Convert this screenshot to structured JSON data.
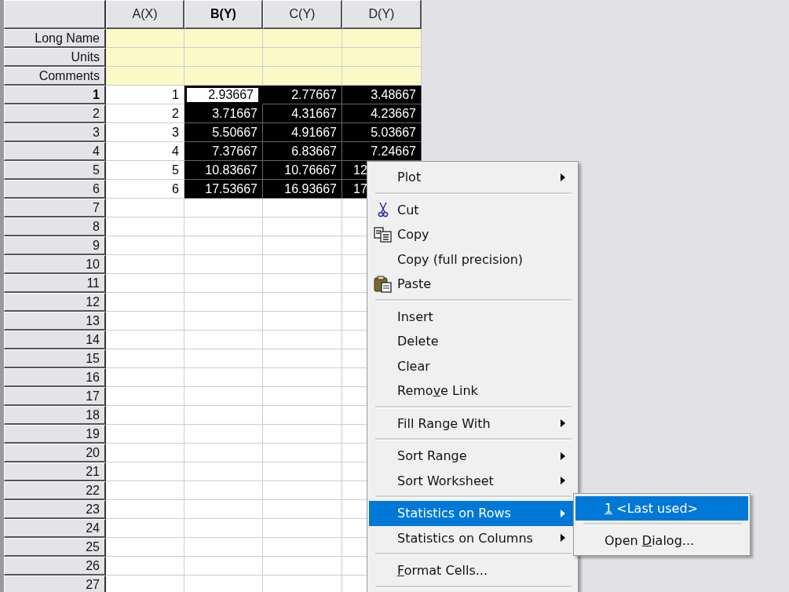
{
  "columns": [
    {
      "label": "A(X)",
      "active": false
    },
    {
      "label": "B(Y)",
      "active": true
    },
    {
      "label": "C(Y)",
      "active": false
    },
    {
      "label": "D(Y)",
      "active": false
    }
  ],
  "label_rows": [
    {
      "label": "Long Name"
    },
    {
      "label": "Units"
    },
    {
      "label": "Comments"
    }
  ],
  "rows": [
    {
      "label": "1",
      "active": true,
      "cells": [
        {
          "value": "1",
          "selected": false,
          "active": false
        },
        {
          "value": "2.93667",
          "selected": true,
          "active": true
        },
        {
          "value": "2.77667",
          "selected": true,
          "active": false
        },
        {
          "value": "3.48667",
          "selected": true,
          "active": false
        }
      ]
    },
    {
      "label": "2",
      "active": false,
      "cells": [
        {
          "value": "2",
          "selected": false,
          "active": false
        },
        {
          "value": "3.71667",
          "selected": true,
          "active": false
        },
        {
          "value": "4.31667",
          "selected": true,
          "active": false
        },
        {
          "value": "4.23667",
          "selected": true,
          "active": false
        }
      ]
    },
    {
      "label": "3",
      "active": false,
      "cells": [
        {
          "value": "3",
          "selected": false,
          "active": false
        },
        {
          "value": "5.50667",
          "selected": true,
          "active": false
        },
        {
          "value": "4.91667",
          "selected": true,
          "active": false
        },
        {
          "value": "5.03667",
          "selected": true,
          "active": false
        }
      ]
    },
    {
      "label": "4",
      "active": false,
      "cells": [
        {
          "value": "4",
          "selected": false,
          "active": false
        },
        {
          "value": "7.37667",
          "selected": true,
          "active": false
        },
        {
          "value": "6.83667",
          "selected": true,
          "active": false
        },
        {
          "value": "7.24667",
          "selected": true,
          "active": false
        }
      ]
    },
    {
      "label": "5",
      "active": false,
      "cells": [
        {
          "value": "5",
          "selected": false,
          "active": false
        },
        {
          "value": "10.83667",
          "selected": true,
          "active": false
        },
        {
          "value": "10.76667",
          "selected": true,
          "active": false
        },
        {
          "value": "12",
          "selected": true,
          "active": false,
          "cut": true
        }
      ]
    },
    {
      "label": "6",
      "active": false,
      "cells": [
        {
          "value": "6",
          "selected": false,
          "active": false
        },
        {
          "value": "17.53667",
          "selected": true,
          "active": false
        },
        {
          "value": "16.93667",
          "selected": true,
          "active": false
        },
        {
          "value": "17",
          "selected": true,
          "active": false,
          "cut": true
        }
      ]
    },
    {
      "label": "7",
      "active": false
    },
    {
      "label": "8",
      "active": false
    },
    {
      "label": "9",
      "active": false
    },
    {
      "label": "10",
      "active": false
    },
    {
      "label": "11",
      "active": false
    },
    {
      "label": "12",
      "active": false
    },
    {
      "label": "13",
      "active": false
    },
    {
      "label": "14",
      "active": false
    },
    {
      "label": "15",
      "active": false
    },
    {
      "label": "16",
      "active": false
    },
    {
      "label": "17",
      "active": false
    },
    {
      "label": "18",
      "active": false
    },
    {
      "label": "19",
      "active": false
    },
    {
      "label": "20",
      "active": false
    },
    {
      "label": "21",
      "active": false
    },
    {
      "label": "22",
      "active": false
    },
    {
      "label": "23",
      "active": false
    },
    {
      "label": "24",
      "active": false
    },
    {
      "label": "25",
      "active": false
    },
    {
      "label": "26",
      "active": false
    },
    {
      "label": "27",
      "active": false
    }
  ],
  "context_menu": {
    "items": [
      {
        "kind": "item",
        "label": [
          {
            "text": "Plot"
          }
        ],
        "submenu": true,
        "highlighted": false
      },
      {
        "kind": "separator"
      },
      {
        "kind": "cut",
        "label": [
          {
            "text": "Cut"
          }
        ],
        "submenu": false,
        "highlighted": false
      },
      {
        "kind": "copy",
        "label": [
          {
            "text": "Copy"
          }
        ],
        "submenu": false,
        "highlighted": false
      },
      {
        "kind": "item",
        "label": [
          {
            "text": "Copy (full precision)"
          }
        ],
        "submenu": false,
        "highlighted": false
      },
      {
        "kind": "paste",
        "label": [
          {
            "text": "Paste"
          }
        ],
        "submenu": false,
        "highlighted": false
      },
      {
        "kind": "separator"
      },
      {
        "kind": "item",
        "label": [
          {
            "text": "Insert"
          }
        ],
        "submenu": false,
        "highlighted": false
      },
      {
        "kind": "item",
        "label": [
          {
            "text": "Delete"
          }
        ],
        "submenu": false,
        "highlighted": false
      },
      {
        "kind": "item",
        "label": [
          {
            "text": "Clear"
          }
        ],
        "submenu": false,
        "highlighted": false
      },
      {
        "kind": "item",
        "label": [
          {
            "text": "Remo"
          },
          {
            "text": "v",
            "underline": true
          },
          {
            "text": "e Link"
          }
        ],
        "submenu": false,
        "highlighted": false
      },
      {
        "kind": "separator"
      },
      {
        "kind": "item",
        "label": [
          {
            "text": "Fill Range With"
          }
        ],
        "submenu": true,
        "highlighted": false
      },
      {
        "kind": "separator"
      },
      {
        "kind": "item",
        "label": [
          {
            "text": "Sort Range"
          }
        ],
        "submenu": true,
        "highlighted": false
      },
      {
        "kind": "item",
        "label": [
          {
            "text": "Sort Worksheet"
          }
        ],
        "submenu": true,
        "highlighted": false
      },
      {
        "kind": "separator"
      },
      {
        "kind": "item",
        "label": [
          {
            "text": "Statistics on Rows"
          }
        ],
        "submenu": true,
        "highlighted": true
      },
      {
        "kind": "item",
        "label": [
          {
            "text": "Statistics on Columns"
          }
        ],
        "submenu": true,
        "highlighted": false
      },
      {
        "kind": "separator"
      },
      {
        "kind": "item",
        "label": [
          {
            "text": "F",
            "underline": true
          },
          {
            "text": "ormat Cells..."
          }
        ],
        "submenu": false,
        "highlighted": false
      },
      {
        "kind": "separator"
      }
    ]
  },
  "submenu": {
    "items": [
      {
        "kind": "item",
        "label": [
          {
            "text": "1",
            "underline": true
          },
          {
            "text": " <Last used>"
          }
        ],
        "highlighted": true
      },
      {
        "kind": "separator"
      },
      {
        "kind": "item",
        "label": [
          {
            "text": "Open "
          },
          {
            "text": "D",
            "underline": true
          },
          {
            "text": "ialog..."
          }
        ],
        "highlighted": false
      }
    ]
  }
}
